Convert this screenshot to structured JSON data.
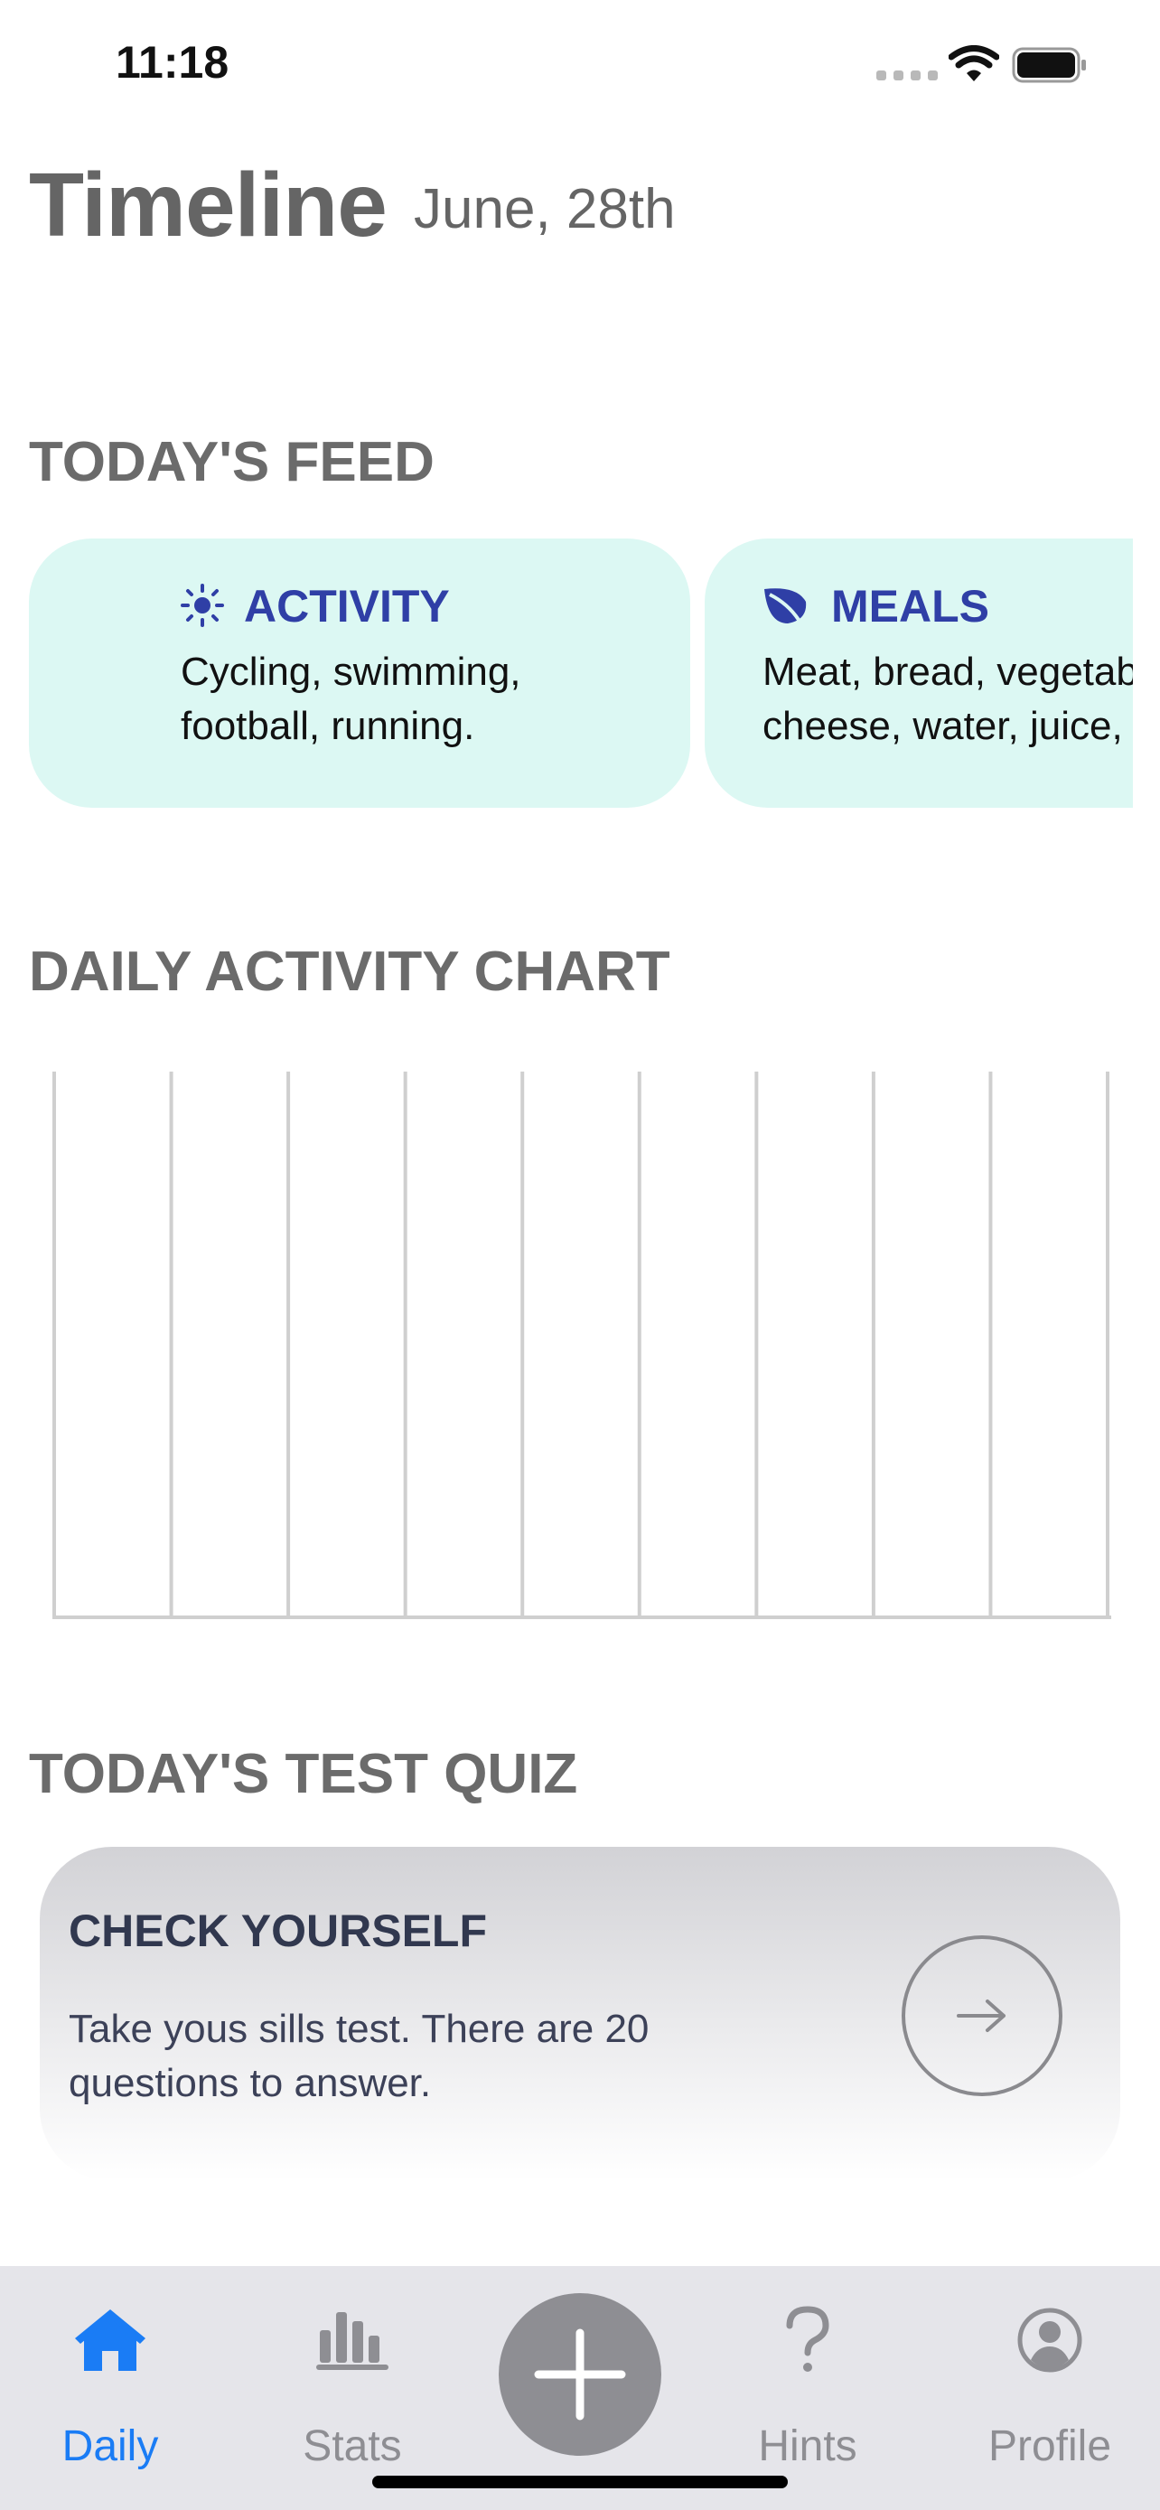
{
  "status_bar": {
    "time": "11:18"
  },
  "header": {
    "title": "Timeline",
    "date": "June, 28th"
  },
  "sections": {
    "feed": "TODAY'S FEED",
    "chart": "DAILY ACTIVITY CHART",
    "quiz": "TODAY'S TEST QUIZ"
  },
  "feed_cards": [
    {
      "title": "ACTIVITY",
      "text": "Cycling, swimming, football, running.",
      "icon": "sun-icon"
    },
    {
      "title": "MEALS",
      "text": "Meat, bread, vegetables, cheese, water, juice,",
      "icon": "leaf-icon"
    }
  ],
  "chart_data": {
    "type": "bar",
    "bars": 10,
    "values": [],
    "title": "",
    "xlabel": "",
    "ylabel": ""
  },
  "quiz": {
    "title": "CHECK YOURSELF",
    "text": "Take yous sills test. There are 20 questions to answer.",
    "action_icon": "arrow-right-icon"
  },
  "tabs": [
    {
      "label": "Daily",
      "icon": "home-icon",
      "active": true
    },
    {
      "label": "Stats",
      "icon": "bar-chart-icon",
      "active": false
    },
    {
      "label": "",
      "icon": "plus-icon",
      "active": false
    },
    {
      "label": "Hints",
      "icon": "question-icon",
      "active": false
    },
    {
      "label": "Profile",
      "icon": "profile-icon",
      "active": false
    }
  ],
  "colors": {
    "accent": "#1a7cf5",
    "card_bg": "#dcf8f3",
    "card_title": "#2f3fa6",
    "section_text": "#6b6b6b"
  }
}
